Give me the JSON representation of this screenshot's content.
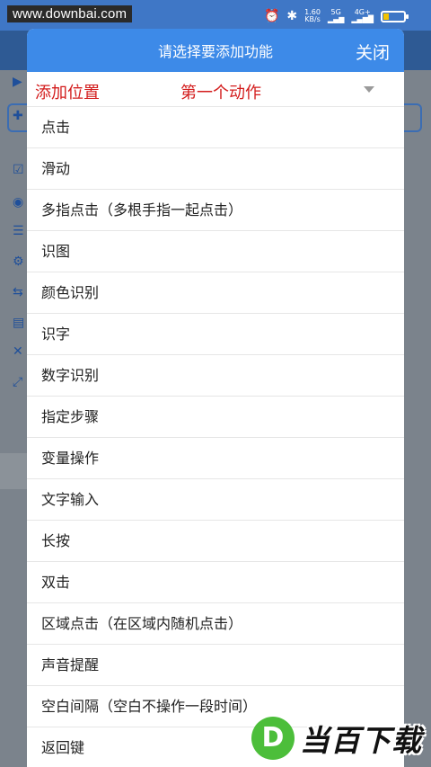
{
  "status_bar": {
    "watermark": "www.downbai.com",
    "icons": [
      "alarm-icon",
      "bluetooth-icon"
    ],
    "net_speed": "1.60",
    "net_speed_unit": "KB/s",
    "net1": "5G",
    "net2": "4G+",
    "battery_level": 0.25
  },
  "dialog": {
    "title": "请选择要添加功能",
    "close_label": "关闭",
    "position_label": "添加位置",
    "position_value": "第一个动作",
    "items": [
      "点击",
      "滑动",
      "多指点击（多根手指一起点击）",
      "识图",
      "颜色识别",
      "识字",
      "数字识别",
      "指定步骤",
      "变量操作",
      "文字输入",
      "长按",
      "双击",
      "区域点击（在区域内随机点击）",
      "声音提醒",
      "空白间隔（空白不操作一段时间）",
      "返回键"
    ]
  },
  "logo": {
    "letter": "D",
    "text": "当百下载"
  },
  "colors": {
    "header_blue": "#3d8ae8",
    "position_red": "#d31c1c",
    "logo_green": "#4cbe3a"
  }
}
